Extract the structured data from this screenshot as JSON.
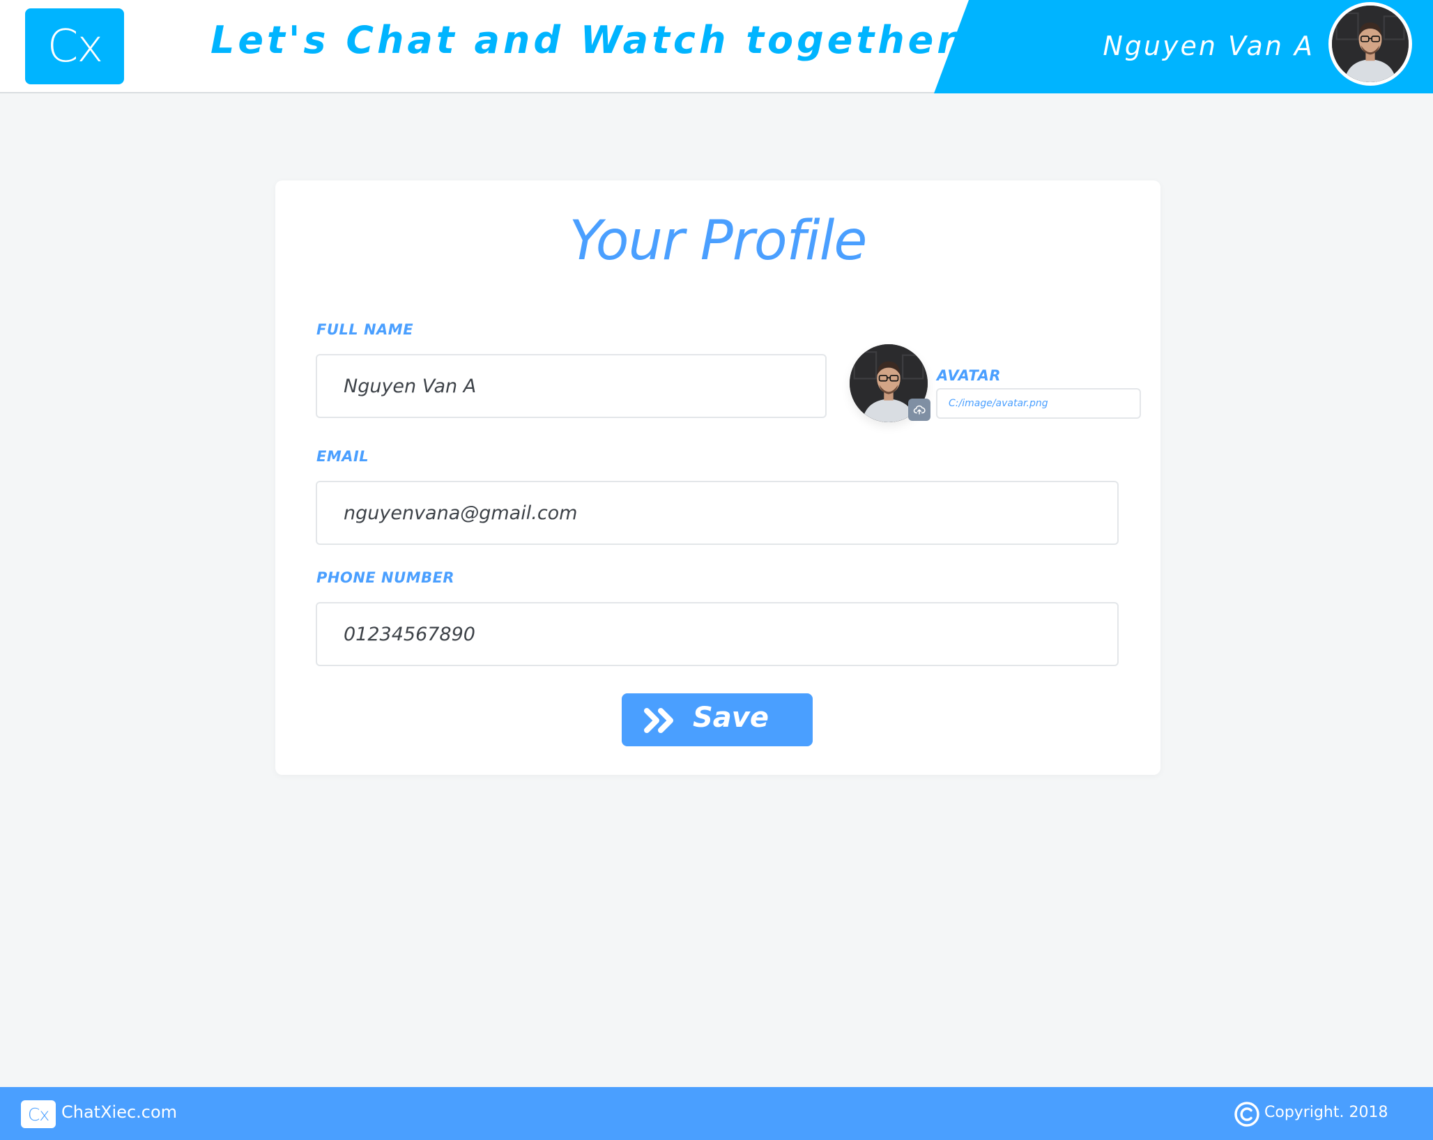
{
  "header": {
    "logo_text": "Cx",
    "tagline": "Let's Chat and Watch together!",
    "user_name": "Nguyen Van A"
  },
  "profile": {
    "title": "Your Profile",
    "full_name": {
      "label": "FULL NAME",
      "value": "Nguyen Van A"
    },
    "avatar": {
      "label": "AVATAR",
      "path": "C:/image/avatar.png"
    },
    "email": {
      "label": "EMAIL",
      "value": "nguyenvana@gmail.com"
    },
    "phone": {
      "label": "PHONE NUMBER",
      "value": "01234567890"
    },
    "save_label": "Save"
  },
  "footer": {
    "logo_text": "Cx",
    "site": "ChatXiec.com",
    "copyright": "Copyright. 2018"
  },
  "colors": {
    "primary": "#00b4ff",
    "accent": "#4a9fff",
    "page_bg": "#f4f6f7",
    "card_bg": "#ffffff"
  },
  "icons": {
    "save": "double-chevron-right-icon",
    "upload": "cloud-upload-icon",
    "copyright": "copyright-icon"
  }
}
